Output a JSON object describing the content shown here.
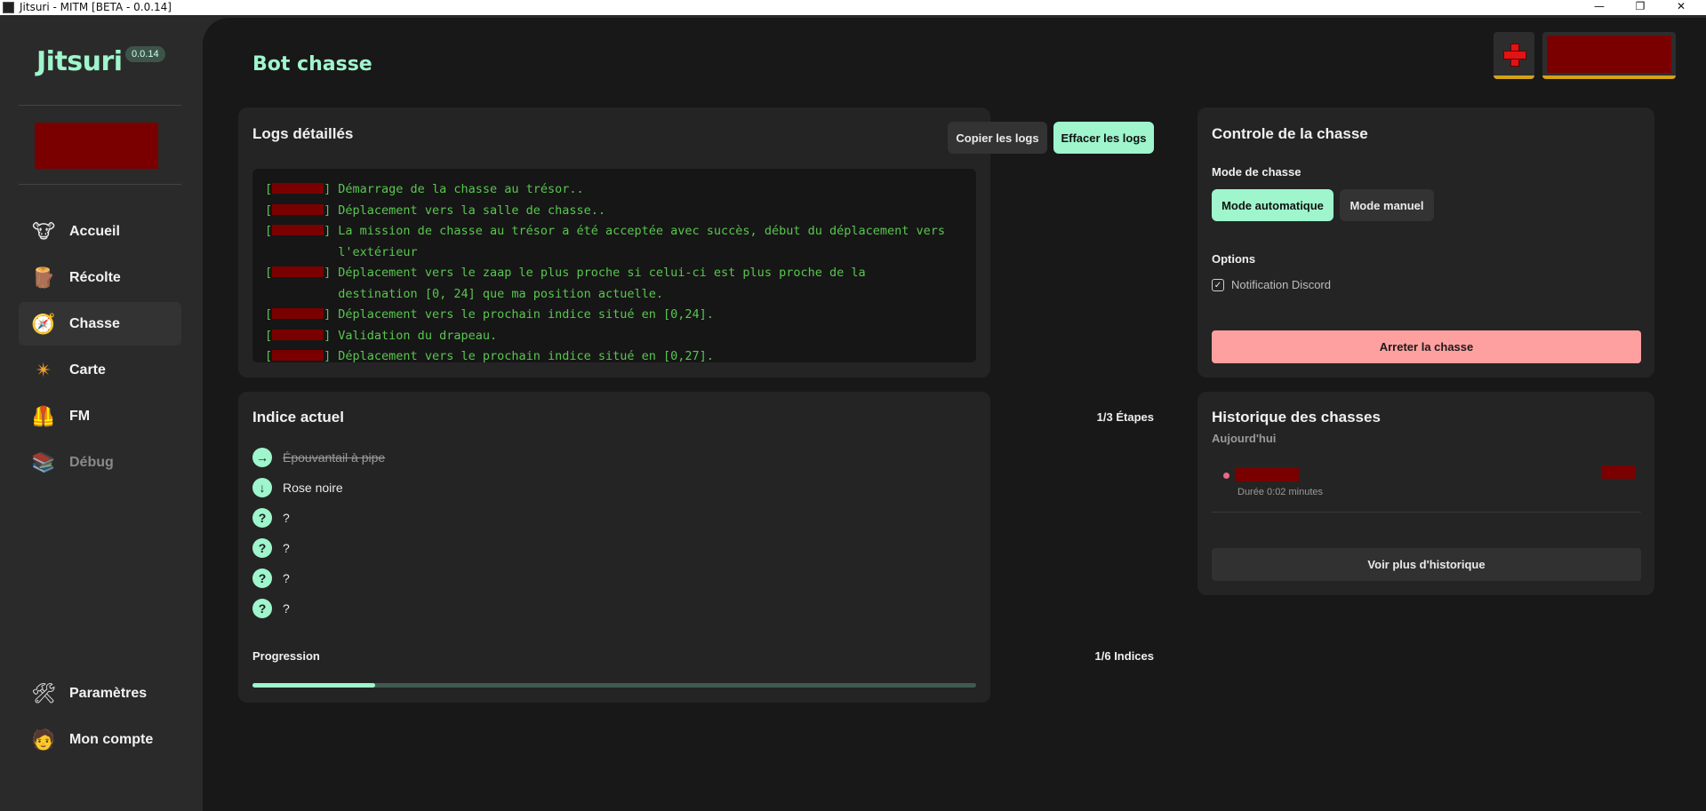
{
  "window": {
    "title": "Jitsuri - MITM [BETA - 0.0.14]",
    "controls": {
      "minimize": "—",
      "restore": "❐",
      "close": "✕"
    }
  },
  "sidebar": {
    "brand": "Jitsuri",
    "version": "0.0.14",
    "nav": [
      {
        "label": "Accueil",
        "icon": "🐮"
      },
      {
        "label": "Récolte",
        "icon": "🪵"
      },
      {
        "label": "Chasse",
        "icon": "🧭"
      },
      {
        "label": "Carte",
        "icon": "✴"
      },
      {
        "label": "FM",
        "icon": "🦺"
      },
      {
        "label": "Débug",
        "icon": "📚"
      }
    ],
    "bottom": [
      {
        "label": "Paramètres",
        "icon": "🛠"
      },
      {
        "label": "Mon compte",
        "icon": "🧑"
      }
    ]
  },
  "header": {
    "title": "Bot chasse"
  },
  "logs": {
    "title": "Logs détaillés",
    "copy_label": "Copier les logs",
    "clear_label": "Effacer les logs",
    "lines": [
      "Démarrage de la chasse au trésor..",
      "Déplacement vers la salle de chasse..",
      "La mission de chasse au trésor a été acceptée avec succès, début du déplacement vers l'extérieur",
      "Déplacement vers le zaap le plus proche si celui-ci est plus proche de la destination [0, 24] que ma position actuelle.",
      "Déplacement vers le prochain indice situé en [0,24].",
      "Validation du drapeau.",
      "Déplacement vers le prochain indice situé en [0,27]."
    ]
  },
  "indice": {
    "title": "Indice actuel",
    "steps_label": "1/3 Étapes",
    "items": [
      {
        "label": "Épouvantail à pipe",
        "icon": "→",
        "done": true
      },
      {
        "label": "Rose noire",
        "icon": "↓",
        "done": false
      },
      {
        "label": "?",
        "icon": "?",
        "done": false
      },
      {
        "label": "?",
        "icon": "?",
        "done": false
      },
      {
        "label": "?",
        "icon": "?",
        "done": false
      },
      {
        "label": "?",
        "icon": "?",
        "done": false
      }
    ],
    "progress_label": "Progression",
    "progress_count": "1/6 Indices",
    "progress_fraction": 0.17
  },
  "control": {
    "title": "Controle de la chasse",
    "mode_label": "Mode de chasse",
    "auto_label": "Mode automatique",
    "manual_label": "Mode manuel",
    "options_label": "Options",
    "discord_label": "Notification Discord",
    "discord_checked": true,
    "stop_label": "Arreter la chasse"
  },
  "history": {
    "title": "Historique des chasses",
    "subtitle": "Aujourd'hui",
    "duration": "Durée 0:02 minutes",
    "more_label": "Voir plus d'historique"
  },
  "colors": {
    "accent": "#9ff5cc",
    "stop": "#ffa0a0",
    "log": "#59c64f"
  }
}
